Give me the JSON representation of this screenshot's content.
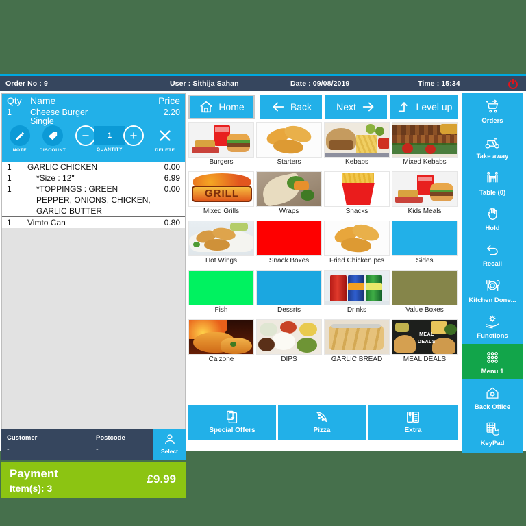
{
  "colors": {
    "accent": "#22b0e8",
    "header_bg": "#36465e",
    "payment_green": "#8cc412",
    "menu_green": "#12a54a",
    "power_red": "#e0141b",
    "letterbox": "#46704c"
  },
  "topbar": {
    "order_no": "Order No : 9",
    "user": "User : Sithija Sahan",
    "date": "Date : 09/08/2019",
    "time": "Time : 15:34",
    "power_icon": "power-icon"
  },
  "order_panel": {
    "columns": {
      "qty": "Qty",
      "name": "Name",
      "price": "Price"
    },
    "selected_item": {
      "qty": "1",
      "name": "Cheese Burger",
      "name_sub": "Single",
      "price": "2.20",
      "quantity_value": "1",
      "actions": {
        "note": "NOTE",
        "discount": "DISCOUNT",
        "quantity": "QUANTITY",
        "delete": "DELETE",
        "minus": "−",
        "plus": "+"
      }
    },
    "lines": [
      {
        "qty": "1",
        "name": "GARLIC CHICKEN",
        "price": "0.00",
        "indent": false,
        "separator": false
      },
      {
        "qty": "1",
        "name": "*Size : 12\"",
        "price": "6.99",
        "indent": true,
        "separator": false
      },
      {
        "qty": "1",
        "name": "*TOPPINGS : GREEN PEPPER, ONIONS, CHICKEN, GARLIC BUTTER",
        "price": "0.00",
        "indent": true,
        "separator": false
      },
      {
        "qty": "1",
        "name": "Vimto Can",
        "price": "0.80",
        "indent": false,
        "separator": true
      }
    ]
  },
  "customer": {
    "customer_label": "Customer",
    "customer_value": "-",
    "postcode_label": "Postcode",
    "postcode_value": "-",
    "select_label": "Select",
    "select_icon": "person-icon"
  },
  "payment": {
    "title": "Payment",
    "items": "Item(s): 3",
    "amount": "£9.99"
  },
  "nav": [
    {
      "label": "Home",
      "icon": "home-icon"
    },
    {
      "label": "Back",
      "icon": "arrow-left-icon"
    },
    {
      "label": "Next",
      "icon": "arrow-right-icon"
    },
    {
      "label": "Level up",
      "icon": "arrow-up-turn-icon"
    }
  ],
  "categories": [
    {
      "label": "Burgers",
      "kind": "photo",
      "art": "burger"
    },
    {
      "label": "Starters",
      "kind": "photo",
      "art": "nuggets"
    },
    {
      "label": "Kebabs",
      "kind": "photo",
      "art": "kebab"
    },
    {
      "label": "Mixed Kebabs",
      "kind": "photo",
      "art": "mixedkebab"
    },
    {
      "label": "Mixed Grills",
      "kind": "photo",
      "art": "grill"
    },
    {
      "label": "Wraps",
      "kind": "photo",
      "art": "wrap"
    },
    {
      "label": "Snacks",
      "kind": "photo",
      "art": "fries"
    },
    {
      "label": "Kids Meals",
      "kind": "photo",
      "art": "burger"
    },
    {
      "label": "Hot Wings",
      "kind": "photo",
      "art": "wings"
    },
    {
      "label": "Snack Boxes",
      "kind": "color",
      "color": "#fe0000"
    },
    {
      "label": "Fried Chicken pcs",
      "kind": "photo",
      "art": "nuggets"
    },
    {
      "label": "Sides",
      "kind": "color",
      "color": "#22b0e8"
    },
    {
      "label": "Fish",
      "kind": "color",
      "color": "#00f260"
    },
    {
      "label": "Dessrts",
      "kind": "color",
      "color": "#1ba7e0"
    },
    {
      "label": "Drinks",
      "kind": "photo",
      "art": "cans"
    },
    {
      "label": "Value Boxes",
      "kind": "color",
      "color": "#85854a"
    },
    {
      "label": "Calzone",
      "kind": "photo",
      "art": "calzone"
    },
    {
      "label": "DIPS",
      "kind": "photo",
      "art": "dips"
    },
    {
      "label": "GARLIC BREAD",
      "kind": "photo",
      "art": "bread"
    },
    {
      "label": "MEAL DEALS",
      "kind": "photo",
      "art": "mealdeals"
    }
  ],
  "bottom_buttons": [
    {
      "label": "Special Offers",
      "icon": "clipboard-star-icon"
    },
    {
      "label": "Pizza",
      "icon": "pizza-slice-icon"
    },
    {
      "label": "Extra",
      "icon": "menu-book-icon"
    }
  ],
  "sidebar": [
    {
      "label": "Orders",
      "icon": "cart-arrow-icon",
      "active": false
    },
    {
      "label": "Take away",
      "icon": "scooter-icon",
      "active": false
    },
    {
      "label": "Table (0)",
      "icon": "table-chairs-icon",
      "active": false
    },
    {
      "label": "Hold",
      "icon": "hand-icon",
      "active": false
    },
    {
      "label": "Recall",
      "icon": "undo-arrow-icon",
      "active": false
    },
    {
      "label": "Kitchen Done...",
      "icon": "cutlery-icon",
      "active": false
    },
    {
      "label": "Functions",
      "icon": "gear-hand-icon",
      "active": false
    },
    {
      "label": "Menu 1",
      "icon": "grid-dots-icon",
      "active": true
    },
    {
      "label": "Back Office",
      "icon": "house-gear-icon",
      "active": false
    },
    {
      "label": "KeyPad",
      "icon": "keypad-hand-icon",
      "active": false
    }
  ]
}
